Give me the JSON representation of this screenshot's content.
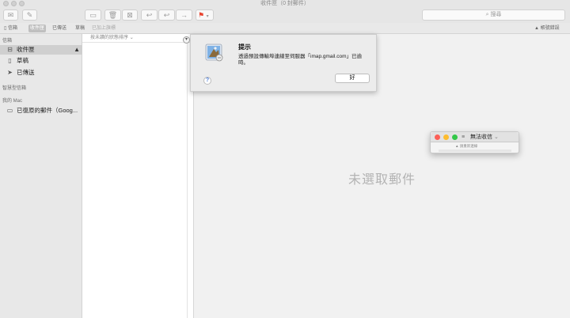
{
  "window": {
    "title": "收件匣（0 封郵件）"
  },
  "toolbar": {
    "search_placeholder": "搜尋",
    "icons": [
      "compose-icon",
      "new-message-icon",
      "archive-icon",
      "trash-icon",
      "junk-icon",
      "reply-icon",
      "reply-all-icon",
      "forward-icon",
      "flag-icon"
    ]
  },
  "favorites": {
    "items": [
      {
        "label": "信箱"
      },
      {
        "label": "收件匣"
      },
      {
        "label": "已傳送"
      },
      {
        "label": "草稿"
      },
      {
        "label": "已加上旗標"
      }
    ],
    "status": "帳號錯誤"
  },
  "sidebar": {
    "section_mailboxes": "信箱",
    "items": [
      {
        "label": "收件匣"
      },
      {
        "label": "草稿"
      },
      {
        "label": "已傳送"
      }
    ],
    "section_smart": "智慧型信箱",
    "section_mac": "我的 Mac",
    "mac_items": [
      {
        "label": "已復原的郵件（Goog..."
      }
    ]
  },
  "message_list": {
    "sort_label": "按未讀的狀態排序"
  },
  "viewer": {
    "empty_label": "未選取郵件"
  },
  "alert": {
    "title": "提示",
    "message": "透過預設傳輸埠連線至伺服器「imap.gmail.com」已逾時。",
    "ok_label": "好",
    "help_label": "?"
  },
  "mini_window": {
    "title": "無法收信",
    "subtitle": "請重新連線"
  },
  "colors": {
    "close": "#fc5f57",
    "minimize": "#fdbc2e",
    "zoom": "#33c748",
    "flag": "#e8432e",
    "help": "#4b7bd8"
  }
}
